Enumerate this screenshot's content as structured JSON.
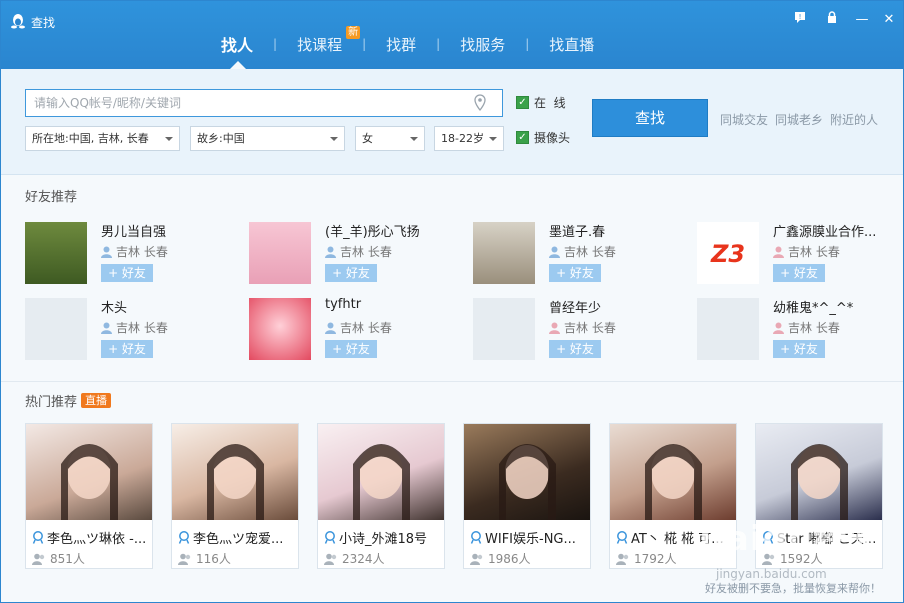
{
  "window": {
    "title": "查找",
    "min_label": "—",
    "close_label": "✕"
  },
  "tabs": [
    {
      "label": "找人",
      "active": true
    },
    {
      "label": "找课程",
      "badge": "新"
    },
    {
      "label": "找群"
    },
    {
      "label": "找服务"
    },
    {
      "label": "找直播"
    }
  ],
  "search": {
    "placeholder": "请输入QQ帐号/昵称/关键词",
    "location": "所在地:中国, 吉林, 长春",
    "hometown": "故乡:中国",
    "gender": "女",
    "age": "18-22岁",
    "online_label": "在  线",
    "camera_label": "摄像头",
    "find_label": "查找",
    "quick_links": [
      "同城交友",
      "同城老乡",
      "附近的人"
    ]
  },
  "friends_section": {
    "title": "好友推荐",
    "add_label": "+ 好友",
    "items": [
      {
        "name": "男儿当自强",
        "location": "吉林 长春",
        "gender": "male"
      },
      {
        "name": "(羊_羊)彤心飞扬",
        "location": "吉林 长春",
        "gender": "male"
      },
      {
        "name": "墨道子.春",
        "location": "吉林 长春",
        "gender": "male"
      },
      {
        "name": "广鑫源膜业合作...",
        "location": "吉林 长春",
        "gender": "female"
      },
      {
        "name": "木头",
        "location": "吉林 长春",
        "gender": "male"
      },
      {
        "name": "tyfhtr",
        "location": "吉林 长春",
        "gender": "male"
      },
      {
        "name": "曾经年少",
        "location": "吉林 长春",
        "gender": "female"
      },
      {
        "name": "幼稚鬼*^_^*",
        "location": "吉林 长春",
        "gender": "female"
      }
    ]
  },
  "hot_section": {
    "title": "热门推荐",
    "badge": "直播",
    "cards": [
      {
        "title": "李色灬ツ琳依 -...",
        "viewers": "851人"
      },
      {
        "title": "李色灬ツ宠爱...",
        "viewers": "116人"
      },
      {
        "title": "小诗_外滩18号",
        "viewers": "2324人"
      },
      {
        "title": "WIFI娱乐-NG...",
        "viewers": "1986人"
      },
      {
        "title": "AT丶 椛 椛 可...",
        "viewers": "1792人"
      },
      {
        "title": "Star 嘟嘟 こ天...",
        "viewers": "1592人"
      }
    ]
  },
  "footer_note": "好友被删不要急，批量恢复来帮你！",
  "watermark": "Baidu经验",
  "watermark_url": "jingyan.baidu.com",
  "colors": {
    "titlebar": "#2a85cf",
    "button": "#2d8fdb",
    "badge_new": "#f59a23",
    "badge_live": "#f0791e"
  }
}
